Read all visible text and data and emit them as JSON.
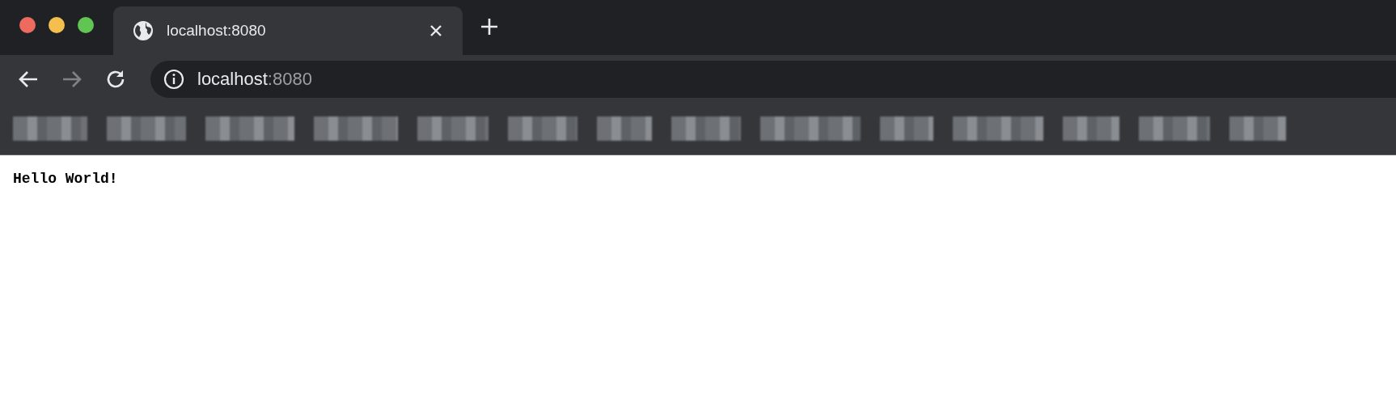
{
  "window": {
    "traffic_lights": [
      {
        "color": "#ed6a5e"
      },
      {
        "color": "#f5bf4f"
      },
      {
        "color": "#61c554"
      }
    ]
  },
  "tabs": [
    {
      "title": "localhost:8080",
      "selected": true
    }
  ],
  "toolbar": {
    "forward_disabled": true
  },
  "address_bar": {
    "host": "localhost",
    "port": ":8080"
  },
  "bookmarks": [
    {
      "kind": "redacted"
    },
    {
      "kind": "redacted"
    },
    {
      "kind": "redacted"
    },
    {
      "kind": "redacted"
    },
    {
      "kind": "redacted"
    },
    {
      "kind": "redacted"
    },
    {
      "kind": "redacted"
    },
    {
      "kind": "redacted"
    },
    {
      "kind": "redacted"
    },
    {
      "kind": "redacted"
    },
    {
      "kind": "redacted"
    },
    {
      "kind": "redacted"
    },
    {
      "kind": "redacted"
    },
    {
      "kind": "redacted"
    }
  ],
  "page": {
    "text": "Hello World!"
  }
}
